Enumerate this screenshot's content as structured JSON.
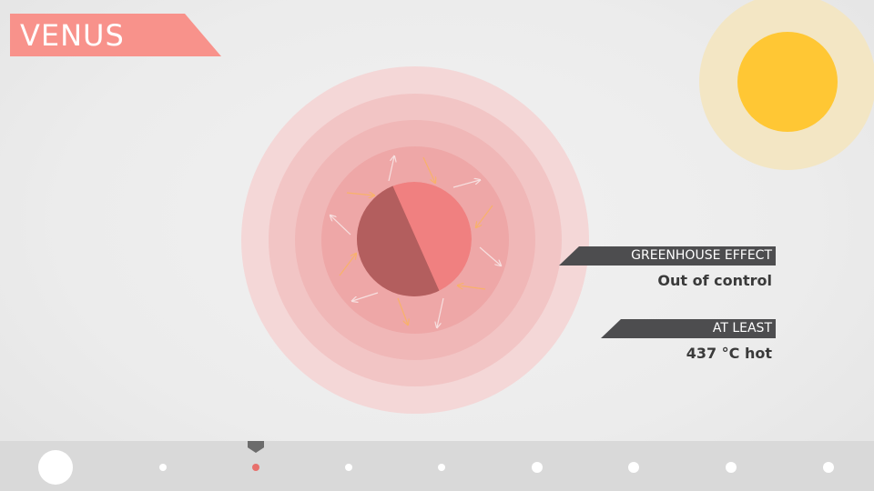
{
  "title": "VENUS",
  "facts": [
    {
      "label": "GREENHOUSE EFFECT",
      "value": "Out of control"
    },
    {
      "label": "AT LEAST",
      "value": "437 °C hot"
    }
  ],
  "timeline": {
    "count": 9,
    "active_index": 2,
    "accent": "#e8706c"
  },
  "colors": {
    "banner": "#f8928b",
    "planet_light": "#f08080",
    "planet_dark": "#b35e5e",
    "sun_core": "#ffc734",
    "sun_glow": "#f3e6c4"
  }
}
